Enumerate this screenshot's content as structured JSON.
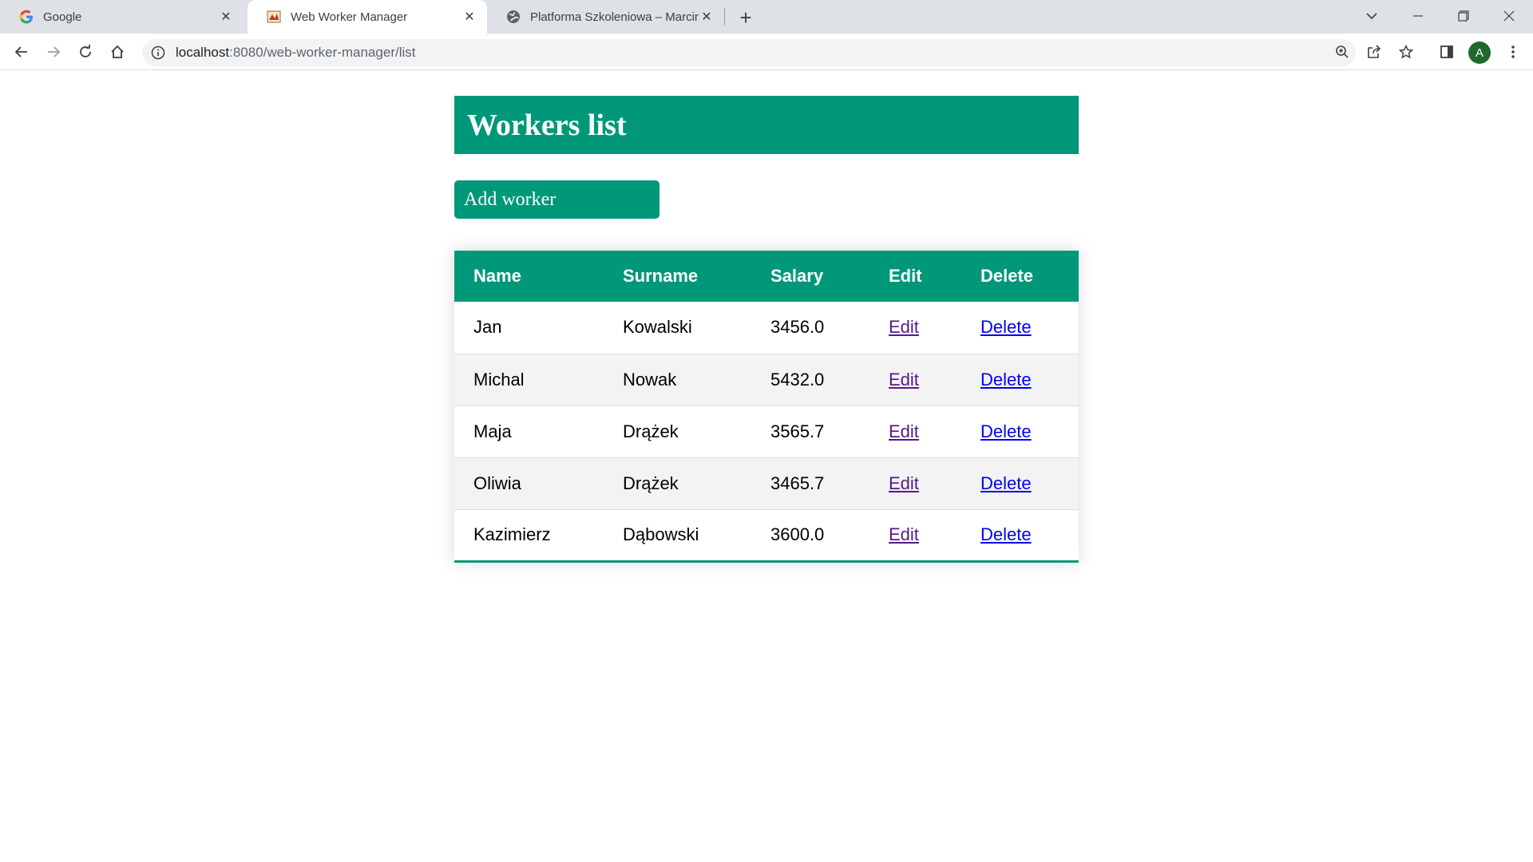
{
  "browser": {
    "tabs": [
      {
        "title": "Google",
        "icon": "google-icon",
        "active": false
      },
      {
        "title": "Web Worker Manager",
        "icon": "app-icon",
        "active": true
      },
      {
        "title": "Platforma Szkoleniowa – Marcin",
        "icon": "globe-icon",
        "active": false
      }
    ],
    "close_glyph": "✕",
    "new_tab_glyph": "+",
    "url_host": "localhost",
    "url_path": ":8080/web-worker-manager/list",
    "profile_initial": "A",
    "profile_color": "#1e6a2d"
  },
  "page": {
    "title": "Workers list",
    "add_button": "Add worker",
    "accent_color": "#009879",
    "table": {
      "headers": [
        "Name",
        "Surname",
        "Salary",
        "Edit",
        "Delete"
      ],
      "rows": [
        {
          "name": "Jan",
          "surname": "Kowalski",
          "salary": "3456.0",
          "edit": "Edit",
          "delete": "Delete"
        },
        {
          "name": "Michal",
          "surname": "Nowak",
          "salary": "5432.0",
          "edit": "Edit",
          "delete": "Delete"
        },
        {
          "name": "Maja",
          "surname": "Drążek",
          "salary": "3565.7",
          "edit": "Edit",
          "delete": "Delete"
        },
        {
          "name": "Oliwia",
          "surname": "Drążek",
          "salary": "3465.7",
          "edit": "Edit",
          "delete": "Delete"
        },
        {
          "name": "Kazimierz",
          "surname": "Dąbowski",
          "salary": "3600.0",
          "edit": "Edit",
          "delete": "Delete"
        }
      ]
    }
  }
}
